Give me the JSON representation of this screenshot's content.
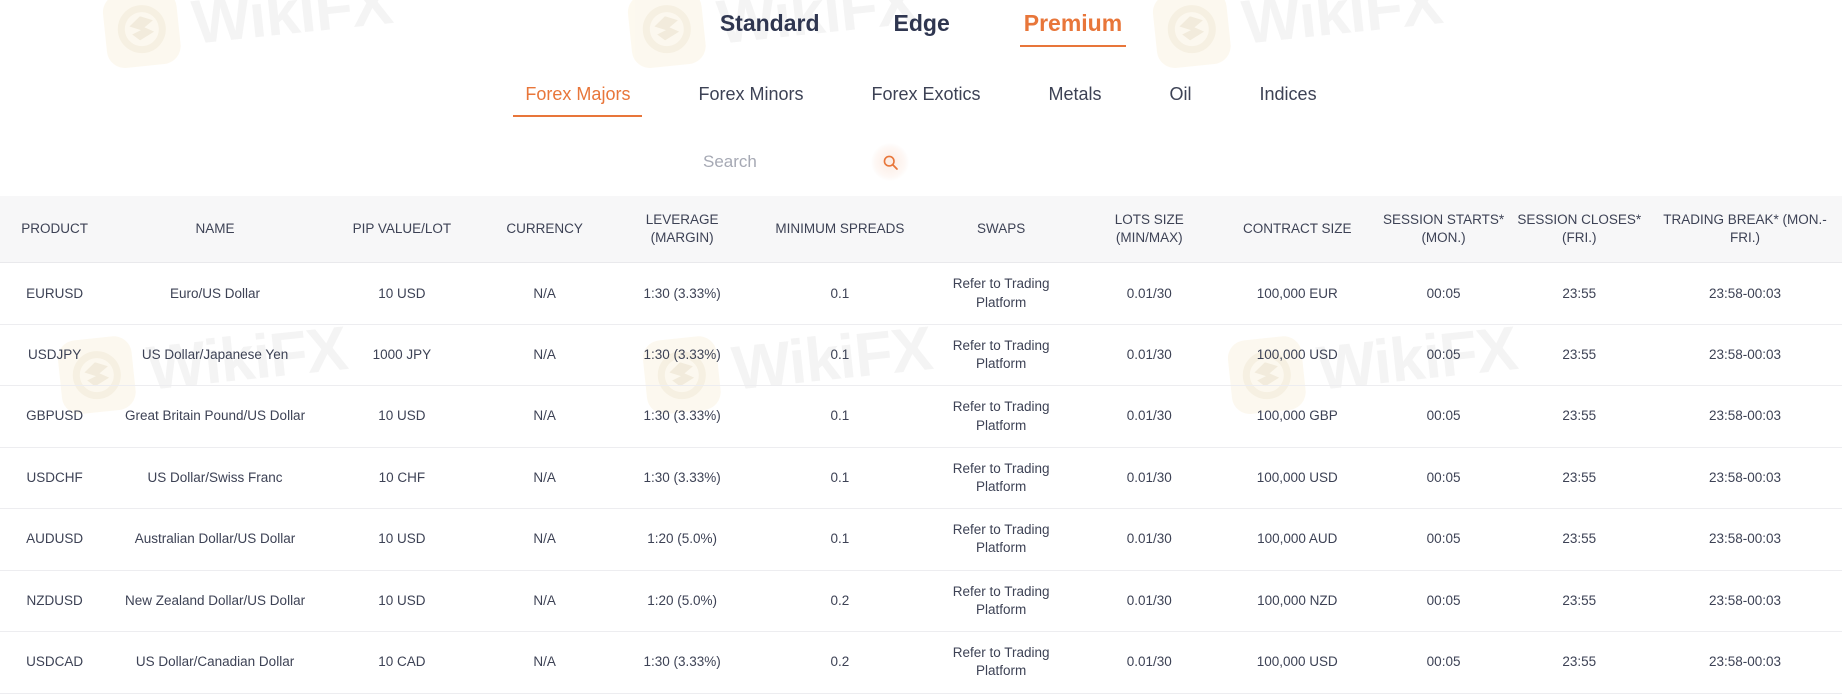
{
  "watermark": {
    "text": "WikiFX",
    "logo_icon": "wikifx-eagle-logo-icon"
  },
  "colors": {
    "accent": "#e8763a",
    "text": "#3d4255",
    "header_bg": "#f7f7f8",
    "row_divider": "#ededf0",
    "placeholder": "#a6a9b4"
  },
  "level_tabs": [
    {
      "label": "Standard",
      "active": false
    },
    {
      "label": "Edge",
      "active": false
    },
    {
      "label": "Premium",
      "active": true
    }
  ],
  "category_tabs": [
    {
      "label": "Forex Majors",
      "active": true
    },
    {
      "label": "Forex Minors",
      "active": false
    },
    {
      "label": "Forex Exotics",
      "active": false
    },
    {
      "label": "Metals",
      "active": false
    },
    {
      "label": "Oil",
      "active": false
    },
    {
      "label": "Indices",
      "active": false
    }
  ],
  "search": {
    "value": "",
    "placeholder": "Search",
    "button_icon": "search-icon"
  },
  "table": {
    "columns": [
      "PRODUCT",
      "NAME",
      "PIP VALUE/LOT",
      "CURRENCY",
      "LEVERAGE (MARGIN)",
      "MINIMUM SPREADS",
      "SWAPS",
      "LOTS SIZE (MIN/MAX)",
      "CONTRACT SIZE",
      "SESSION STARTS* (MON.)",
      "SESSION CLOSES* (FRI.)",
      "TRADING BREAK* (MON.-FRI.)"
    ],
    "columns_multiline": [
      [
        "PRODUCT"
      ],
      [
        "NAME"
      ],
      [
        "PIP VALUE/LOT"
      ],
      [
        "CURRENCY"
      ],
      [
        "LEVERAGE",
        "(MARGIN)"
      ],
      [
        "MINIMUM SPREADS"
      ],
      [
        "SWAPS"
      ],
      [
        "LOTS SIZE",
        "(MIN/MAX)"
      ],
      [
        "CONTRACT SIZE"
      ],
      [
        "SESSION STARTS*",
        "(MON.)"
      ],
      [
        "SESSION CLOSES*",
        "(FRI.)"
      ],
      [
        "TRADING BREAK* (MON.-FRI.)"
      ]
    ],
    "rows": [
      {
        "product": "EURUSD",
        "name": "Euro/US Dollar",
        "pip_value_lot": "10 USD",
        "currency": "N/A",
        "leverage": "1:30 (3.33%)",
        "minimum_spreads": "0.1",
        "swaps": "Refer to Trading Platform",
        "lots_size": "0.01/30",
        "contract_size": "100,000 EUR",
        "session_starts": "00:05",
        "session_closes": "23:55",
        "trading_break": "23:58-00:03"
      },
      {
        "product": "USDJPY",
        "name": "US Dollar/Japanese Yen",
        "pip_value_lot": "1000 JPY",
        "currency": "N/A",
        "leverage": "1:30 (3.33%)",
        "minimum_spreads": "0.1",
        "swaps": "Refer to Trading Platform",
        "lots_size": "0.01/30",
        "contract_size": "100,000 USD",
        "session_starts": "00:05",
        "session_closes": "23:55",
        "trading_break": "23:58-00:03"
      },
      {
        "product": "GBPUSD",
        "name": "Great Britain Pound/US Dollar",
        "pip_value_lot": "10 USD",
        "currency": "N/A",
        "leverage": "1:30 (3.33%)",
        "minimum_spreads": "0.1",
        "swaps": "Refer to Trading Platform",
        "lots_size": "0.01/30",
        "contract_size": "100,000 GBP",
        "session_starts": "00:05",
        "session_closes": "23:55",
        "trading_break": "23:58-00:03"
      },
      {
        "product": "USDCHF",
        "name": "US Dollar/Swiss Franc",
        "pip_value_lot": "10 CHF",
        "currency": "N/A",
        "leverage": "1:30 (3.33%)",
        "minimum_spreads": "0.1",
        "swaps": "Refer to Trading Platform",
        "lots_size": "0.01/30",
        "contract_size": "100,000 USD",
        "session_starts": "00:05",
        "session_closes": "23:55",
        "trading_break": "23:58-00:03"
      },
      {
        "product": "AUDUSD",
        "name": "Australian Dollar/US Dollar",
        "pip_value_lot": "10 USD",
        "currency": "N/A",
        "leverage": "1:20 (5.0%)",
        "minimum_spreads": "0.1",
        "swaps": "Refer to Trading Platform",
        "lots_size": "0.01/30",
        "contract_size": "100,000 AUD",
        "session_starts": "00:05",
        "session_closes": "23:55",
        "trading_break": "23:58-00:03"
      },
      {
        "product": "NZDUSD",
        "name": "New Zealand Dollar/US Dollar",
        "pip_value_lot": "10 USD",
        "currency": "N/A",
        "leverage": "1:20 (5.0%)",
        "minimum_spreads": "0.2",
        "swaps": "Refer to Trading Platform",
        "lots_size": "0.01/30",
        "contract_size": "100,000 NZD",
        "session_starts": "00:05",
        "session_closes": "23:55",
        "trading_break": "23:58-00:03"
      },
      {
        "product": "USDCAD",
        "name": "US Dollar/Canadian Dollar",
        "pip_value_lot": "10 CAD",
        "currency": "N/A",
        "leverage": "1:30 (3.33%)",
        "minimum_spreads": "0.2",
        "swaps": "Refer to Trading Platform",
        "lots_size": "0.01/30",
        "contract_size": "100,000 USD",
        "session_starts": "00:05",
        "session_closes": "23:55",
        "trading_break": "23:58-00:03"
      }
    ]
  }
}
